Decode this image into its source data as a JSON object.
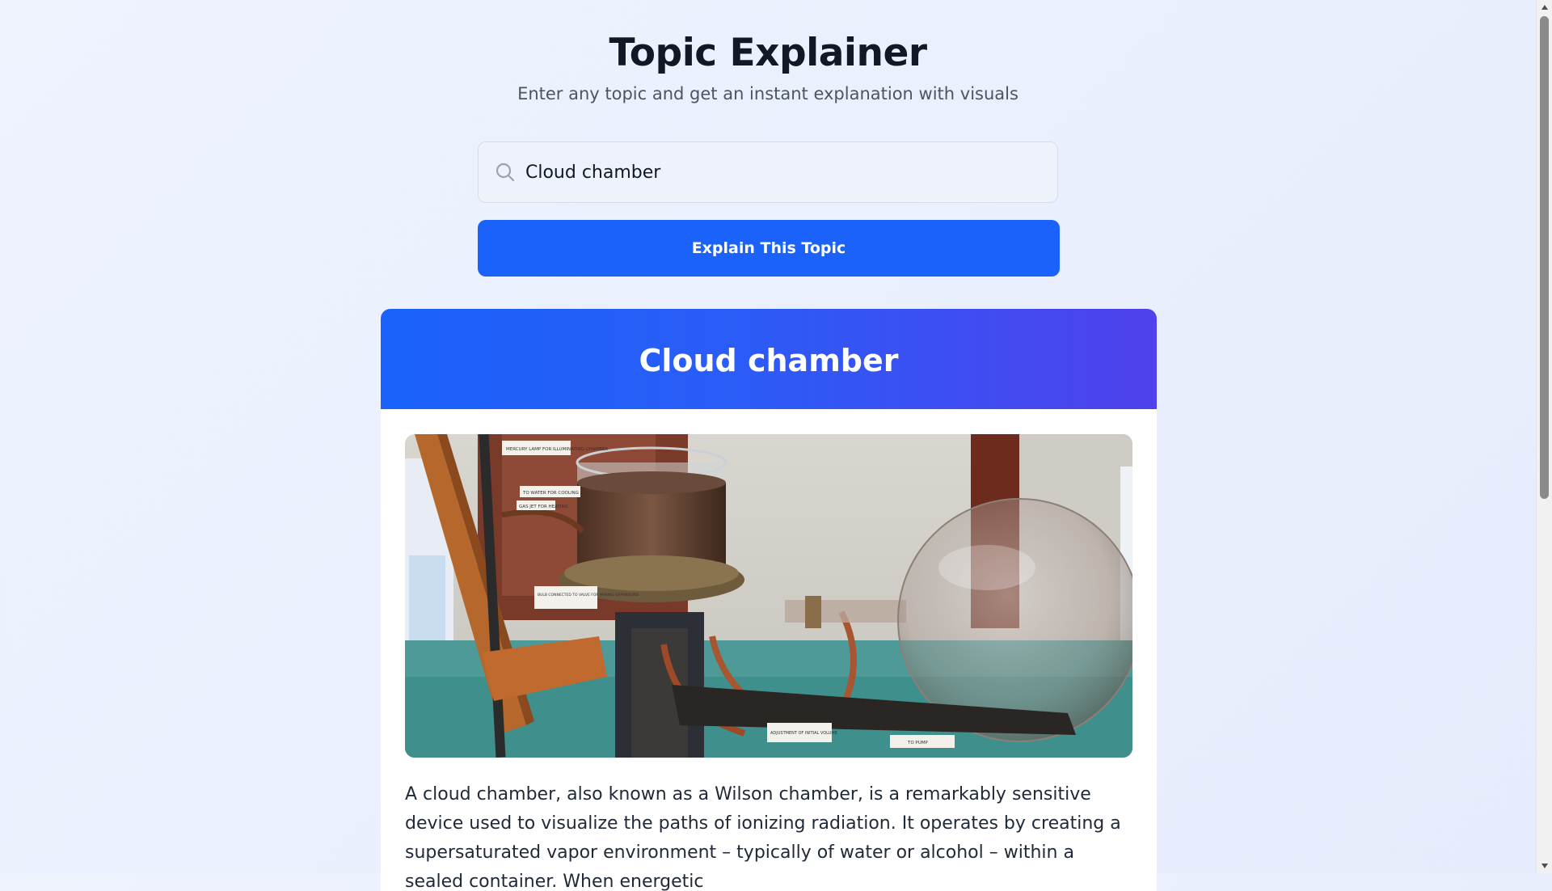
{
  "header": {
    "title": "Topic Explainer",
    "subtitle": "Enter any topic and get an instant explanation with visuals"
  },
  "search": {
    "icon": "search-icon",
    "value": "Cloud chamber",
    "placeholder": ""
  },
  "actions": {
    "explain_label": "Explain This Topic"
  },
  "result": {
    "title": "Cloud chamber",
    "image_labels": [
      "MERCURY LAMP FOR ILLUMINATING CHAMBER",
      "TO WATER FOR COOLING",
      "GAS JET FOR HEATING",
      "BULB CONNECTED TO VALVE FOR MAKING EXPANSIONS",
      "ADJUSTMENT OF INITIAL VOLUME",
      "TO PUMP"
    ],
    "description": "A cloud chamber, also known as a Wilson chamber, is a remarkably sensitive device used to visualize the paths of ionizing radiation. It operates by creating a supersaturated vapor environment – typically of water or alcohol – within a sealed container. When energetic"
  },
  "colors": {
    "accent": "#1a62fa",
    "header_gradient_end": "#4f41ec",
    "background": "#eef3fe"
  },
  "scrollbar": {
    "position_fraction": 0.0,
    "visible_fraction": 0.58
  }
}
